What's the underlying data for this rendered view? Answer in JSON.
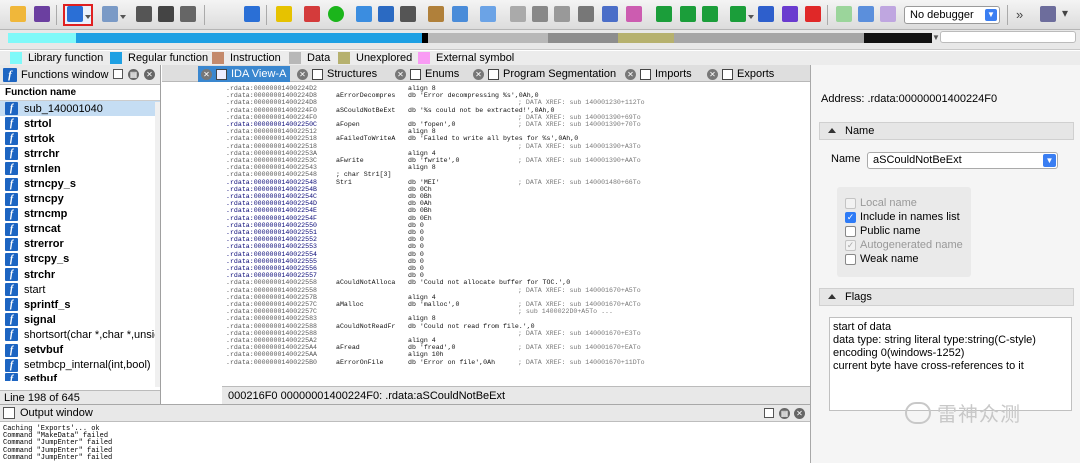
{
  "toolbar": {
    "debugger_label": "No debugger"
  },
  "legend": [
    {
      "label": "Library function",
      "color": "#7ff9f9"
    },
    {
      "label": "Regular function",
      "color": "#1ea0e3"
    },
    {
      "label": "Instruction",
      "color": "#c48a6c"
    },
    {
      "label": "Data",
      "color": "#b8b8b8"
    },
    {
      "label": "Unexplored",
      "color": "#b6b16e"
    },
    {
      "label": "External symbol",
      "color": "#f99bf4"
    }
  ],
  "functions": {
    "title": "Functions window",
    "column": "Function name",
    "items": [
      "sub_140001040",
      "strtol",
      "strtok",
      "strrchr",
      "strnlen",
      "strncpy_s",
      "strncpy",
      "strncmp",
      "strncat",
      "strerror",
      "strcpy_s",
      "strchr",
      "start",
      "sprintf_s",
      "signal",
      "shortsort(char *,char *,unsigr",
      "setvbuf",
      "setmbcp_internal(int,bool)",
      "setbuf"
    ],
    "status": "Line 198 of 645"
  },
  "tabs": [
    {
      "label": "IDA View-A"
    },
    {
      "label": "Structures"
    },
    {
      "label": "Enums"
    },
    {
      "label": "Program Segmentation"
    },
    {
      "label": "Imports"
    },
    {
      "label": "Exports"
    }
  ],
  "disasm": [
    {
      "addr": ".rdata:00000001400224D2",
      "label": "",
      "ins": "align 8",
      "cmt": ""
    },
    {
      "addr": ".rdata:00000001400224D8",
      "label": "aErrorDecompres",
      "ins": "db 'Error decompressing %s',0Ah,0",
      "cmt": ""
    },
    {
      "addr": ".rdata:00000001400224D8",
      "label": "",
      "ins": "",
      "cmt": "; DATA XREF: sub 140001230+112To"
    },
    {
      "addr": ".rdata:00000001400224F0",
      "label": "aSCouldNotBeExt",
      "ins": "db '%s could not be extracted!',0Ah,0",
      "cmt": ""
    },
    {
      "addr": ".rdata:00000001400224F0",
      "label": "",
      "ins": "",
      "cmt": "; DATA XREF: sub 140001390+69To"
    },
    {
      "addr": ".rdata:000000014002250C",
      "label": "aFopen",
      "ins": "db 'fopen',0",
      "cmt": "; DATA XREF: sub 140001390+70To"
    },
    {
      "addr": ".rdata:0000000140022512",
      "label": "",
      "ins": "align 8",
      "cmt": ""
    },
    {
      "addr": ".rdata:0000000140022518",
      "label": "aFailedToWriteA",
      "ins": "db 'Failed to write all bytes for %s',0Ah,0",
      "cmt": ""
    },
    {
      "addr": ".rdata:0000000140022518",
      "label": "",
      "ins": "",
      "cmt": "; DATA XREF: sub 140001390+A3To"
    },
    {
      "addr": ".rdata:000000014002253A",
      "label": "",
      "ins": "align 4",
      "cmt": ""
    },
    {
      "addr": ".rdata:000000014002253C",
      "label": "aFwrite",
      "ins": "db 'fwrite',0",
      "cmt": "; DATA XREF: sub 140001390+AATo"
    },
    {
      "addr": ".rdata:0000000140022543",
      "label": "",
      "ins": "align 8",
      "cmt": ""
    },
    {
      "addr": ".rdata:0000000140022548",
      "label": "; char Str1[3]",
      "ins": "",
      "cmt": ""
    },
    {
      "addr": ".rdata:0000000140022548",
      "label": "Str1",
      "ins": "db 'MEI'",
      "cmt": "; DATA XREF: sub 140001480+66To"
    },
    {
      "addr": ".rdata:000000014002254B",
      "label": "",
      "ins": "db 0Ch",
      "cmt": ""
    },
    {
      "addr": ".rdata:000000014002254C",
      "label": "",
      "ins": "db 0Bh",
      "cmt": ""
    },
    {
      "addr": ".rdata:000000014002254D",
      "label": "",
      "ins": "db 0Ah",
      "cmt": ""
    },
    {
      "addr": ".rdata:000000014002254E",
      "label": "",
      "ins": "db 0Bh",
      "cmt": ""
    },
    {
      "addr": ".rdata:000000014002254F",
      "label": "",
      "ins": "db 0Eh",
      "cmt": ""
    },
    {
      "addr": ".rdata:0000000140022550",
      "label": "",
      "ins": "db 0",
      "cmt": ""
    },
    {
      "addr": ".rdata:0000000140022551",
      "label": "",
      "ins": "db 0",
      "cmt": ""
    },
    {
      "addr": ".rdata:0000000140022552",
      "label": "",
      "ins": "db 0",
      "cmt": ""
    },
    {
      "addr": ".rdata:0000000140022553",
      "label": "",
      "ins": "db 0",
      "cmt": ""
    },
    {
      "addr": ".rdata:0000000140022554",
      "label": "",
      "ins": "db 0",
      "cmt": ""
    },
    {
      "addr": ".rdata:0000000140022555",
      "label": "",
      "ins": "db 0",
      "cmt": ""
    },
    {
      "addr": ".rdata:0000000140022556",
      "label": "",
      "ins": "db 0",
      "cmt": ""
    },
    {
      "addr": ".rdata:0000000140022557",
      "label": "",
      "ins": "db 0",
      "cmt": ""
    },
    {
      "addr": ".rdata:0000000140022558",
      "label": "aCouldNotAlloca",
      "ins": "db 'Could not allocate buffer for TOC.',0",
      "cmt": ""
    },
    {
      "addr": ".rdata:0000000140022558",
      "label": "",
      "ins": "",
      "cmt": "; DATA XREF: sub 140001670+A5To"
    },
    {
      "addr": ".rdata:000000014002257B",
      "label": "",
      "ins": "align 4",
      "cmt": ""
    },
    {
      "addr": ".rdata:000000014002257C",
      "label": "aMalloc",
      "ins": "db 'malloc',0",
      "cmt": "; DATA XREF: sub 140001670+ACTo"
    },
    {
      "addr": ".rdata:000000014002257C",
      "label": "",
      "ins": "",
      "cmt": "; sub 1400022D0+A5To ..."
    },
    {
      "addr": ".rdata:0000000140022583",
      "label": "",
      "ins": "align 8",
      "cmt": ""
    },
    {
      "addr": ".rdata:0000000140022588",
      "label": "aCouldNotReadFr",
      "ins": "db 'Could not read from file.',0",
      "cmt": ""
    },
    {
      "addr": ".rdata:0000000140022588",
      "label": "",
      "ins": "",
      "cmt": "; DATA XREF: sub 140001670+E3To"
    },
    {
      "addr": ".rdata:00000001400225A2",
      "label": "",
      "ins": "align 4",
      "cmt": ""
    },
    {
      "addr": ".rdata:00000001400225A4",
      "label": "aFread",
      "ins": "db 'fread',0",
      "cmt": "; DATA XREF: sub 140001670+EATo"
    },
    {
      "addr": ".rdata:00000001400225AA",
      "label": "",
      "ins": "align 10h",
      "cmt": ""
    },
    {
      "addr": ".rdata:00000001400225B0",
      "label": "aErrorOnFile",
      "ins": "db 'Error on file',0Ah",
      "cmt": "; DATA XREF: sub 140001670+11DTo"
    }
  ],
  "disasm_status": "000216F0 00000001400224F0: .rdata:aSCouldNotBeExt",
  "props": {
    "address": "Address: .rdata:00000001400224F0",
    "name_section": "Name",
    "name_label": "Name",
    "name_value": "aSCouldNotBeExt",
    "checkboxes": [
      {
        "label": "Local name",
        "checked": false,
        "disabled": true
      },
      {
        "label": "Include in names list",
        "checked": true,
        "disabled": false
      },
      {
        "label": "Public name",
        "checked": false,
        "disabled": false
      },
      {
        "label": "Autogenerated name",
        "checked": true,
        "disabled": true
      },
      {
        "label": "Weak name",
        "checked": false,
        "disabled": false
      }
    ],
    "flags_section": "Flags",
    "flags": [
      "start of data",
      "data type: string literal type:string(C-style)",
      "encoding 0(windows-1252)",
      "current byte have cross-references to it"
    ]
  },
  "output": {
    "title": "Output window",
    "lines": [
      "Caching 'Exports'... ok",
      "Command \"MakeData\" failed",
      "Command \"JumpEnter\" failed",
      "Command \"JumpEnter\" failed",
      "Command \"JumpEnter\" failed"
    ]
  },
  "watermark": "雷神众测"
}
